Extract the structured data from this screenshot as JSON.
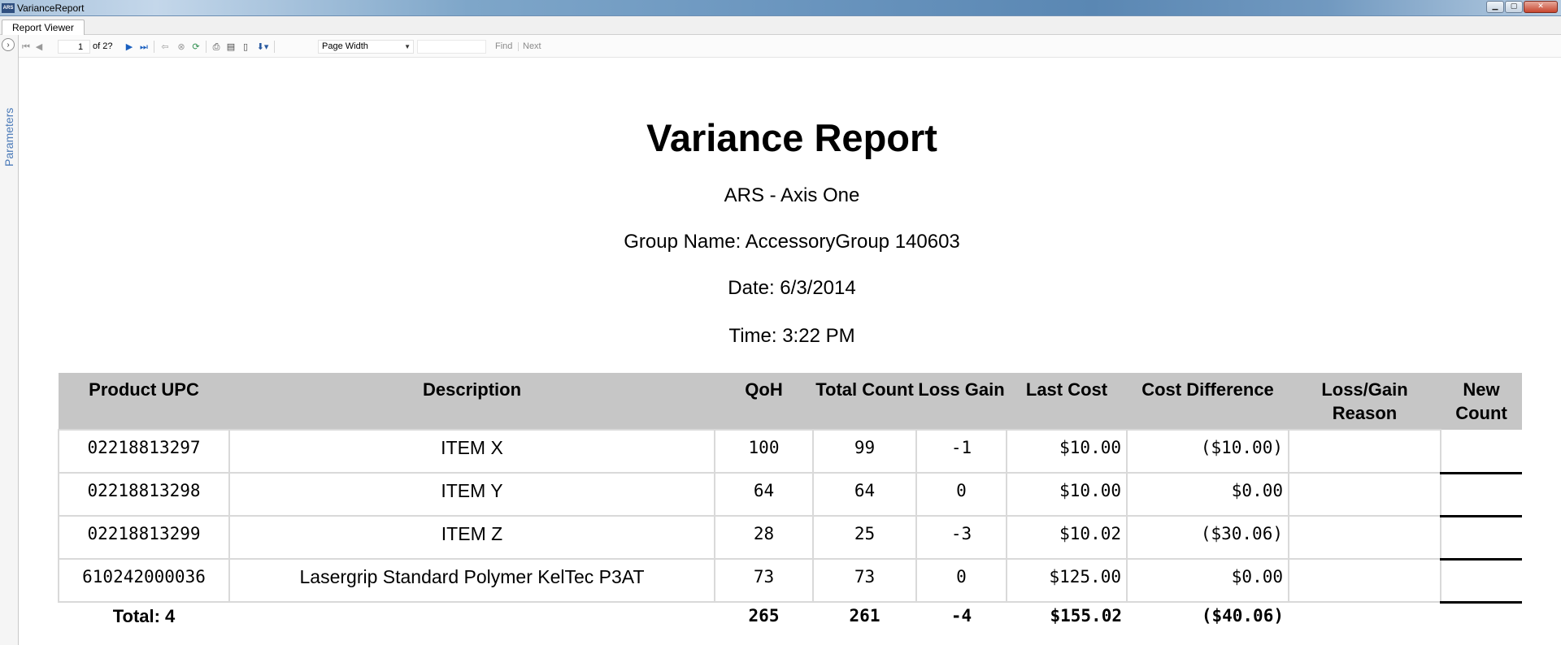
{
  "window": {
    "title": "VarianceReport",
    "app_icon_text": "ARS",
    "buttons": [
      "minimize",
      "maximize",
      "close"
    ]
  },
  "tabs": [
    {
      "label": "Report Viewer"
    }
  ],
  "sidebar": {
    "label": "Parameters"
  },
  "toolbar": {
    "page_current": "1",
    "page_total": "of 2?",
    "zoom": "Page Width",
    "find_label": "Find",
    "next_label": "Next",
    "find_placeholder": "",
    "icons": [
      "first-page-icon",
      "previous-page-icon",
      "next-page-icon",
      "last-page-icon",
      "back-icon",
      "stop-icon",
      "refresh-icon",
      "print-icon",
      "print-layout-icon",
      "page-setup-icon",
      "export-icon"
    ]
  },
  "report": {
    "title": "Variance Report",
    "company": "ARS - Axis One",
    "group_line": "Group Name: AccessoryGroup 140603",
    "date_line": "Date: 6/3/2014",
    "time_line": "Time: 3:22 PM",
    "columns": [
      {
        "label": "Product UPC"
      },
      {
        "label": "Description"
      },
      {
        "label": "QoH"
      },
      {
        "label": "Total Count"
      },
      {
        "label": "Loss Gain"
      },
      {
        "label": "Last Cost"
      },
      {
        "label": "Cost Difference"
      },
      {
        "label": "Loss/Gain Reason"
      },
      {
        "label": "New Count"
      }
    ],
    "rows": [
      {
        "upc": "02218813297",
        "description": "ITEM X",
        "qoh": "100",
        "total_count": "99",
        "loss_gain": "-1",
        "last_cost": "$10.00",
        "cost_difference": "($10.00)",
        "reason": "",
        "new_count": ""
      },
      {
        "upc": "02218813298",
        "description": "ITEM Y",
        "qoh": "64",
        "total_count": "64",
        "loss_gain": "0",
        "last_cost": "$10.00",
        "cost_difference": "$0.00",
        "reason": "",
        "new_count": ""
      },
      {
        "upc": "02218813299",
        "description": "ITEM Z",
        "qoh": "28",
        "total_count": "25",
        "loss_gain": "-3",
        "last_cost": "$10.02",
        "cost_difference": "($30.06)",
        "reason": "",
        "new_count": ""
      },
      {
        "upc": "610242000036",
        "description": "Lasergrip Standard Polymer KelTec P3AT",
        "qoh": "73",
        "total_count": "73",
        "loss_gain": "0",
        "last_cost": "$125.00",
        "cost_difference": "$0.00",
        "reason": "",
        "new_count": ""
      }
    ],
    "totals": {
      "label": "Total: 4",
      "qoh": "265",
      "total_count": "261",
      "loss_gain": "-4",
      "last_cost": "$155.02",
      "cost_difference": "($40.06)"
    }
  }
}
